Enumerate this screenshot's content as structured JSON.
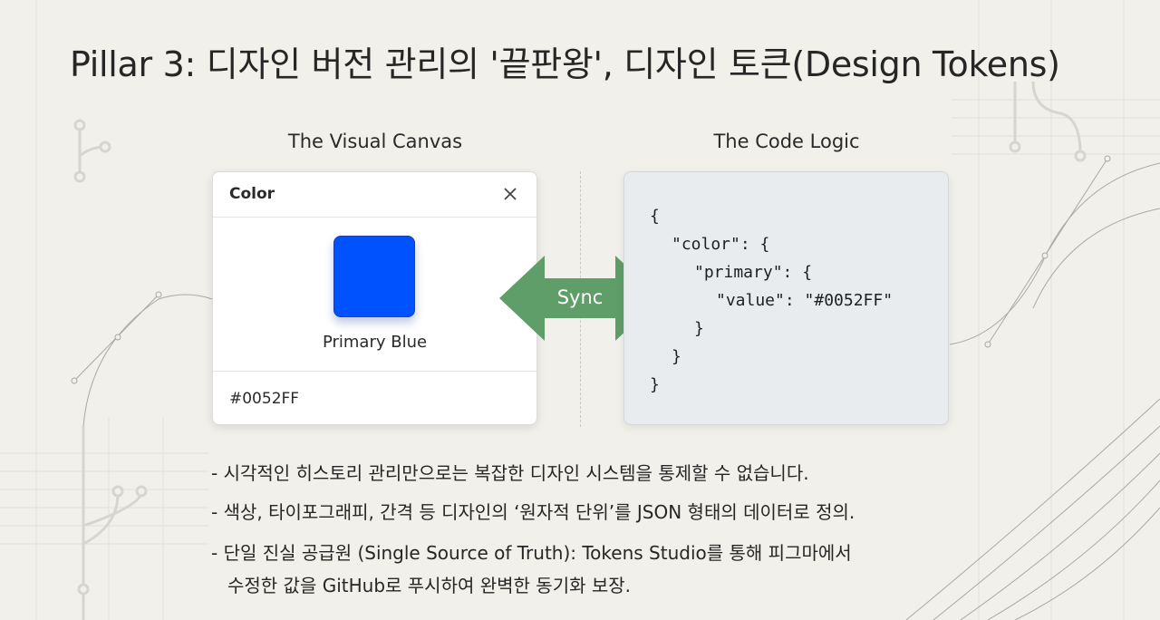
{
  "title": "Pillar 3: 디자인 버전 관리의 '끝판왕', 디자인 토큰(Design Tokens)",
  "visual": {
    "label": "The Visual Canvas",
    "panel_title": "Color",
    "swatch_name": "Primary Blue",
    "swatch_color": "#0052FF",
    "hex_value": "#0052FF",
    "close_icon": "close-icon"
  },
  "sync": {
    "label": "Sync",
    "color": "#5f9e68"
  },
  "code": {
    "label": "The Code Logic",
    "lines": [
      "{",
      "\"color\": {",
      "\"primary\": {",
      "\"value\": \"#0052FF\"",
      "}",
      "}",
      "}"
    ]
  },
  "bullets": [
    "- 시각적인 히스토리 관리만으로는 복잡한 디자인 시스템을 통제할 수 없습니다.",
    "- 색상, 타이포그래피, 간격 등 디자인의 ‘원자적 단위’를 JSON 형태의 데이터로 정의.",
    "- 단일 진실 공급원 (Single Source of Truth): Tokens Studio를 통해 피그마에서",
    "수정한 값을 GitHub로 푸시하여 완벽한 동기화 보장."
  ]
}
